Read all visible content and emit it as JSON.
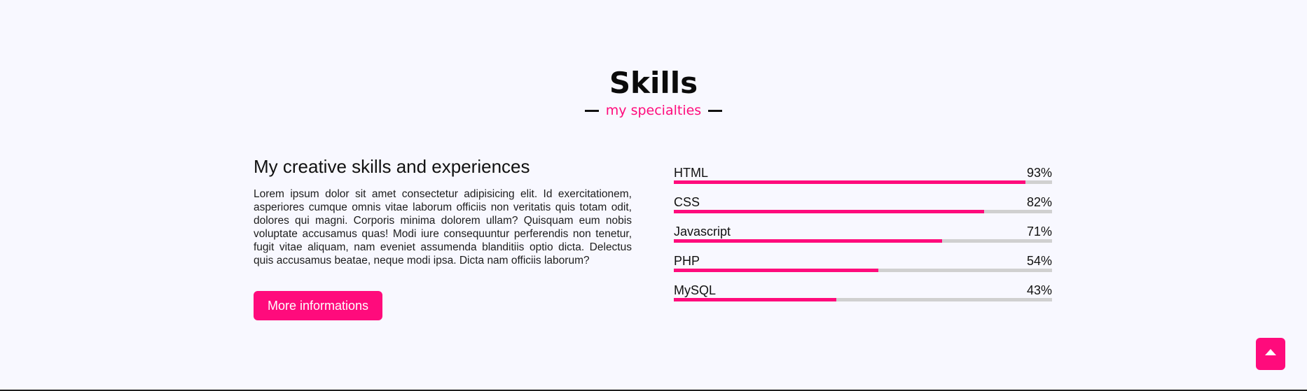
{
  "section": {
    "title": "Skills",
    "subtitle": "my specialties"
  },
  "left": {
    "heading": "My creative skills and experiences",
    "paragraph": "Lorem ipsum dolor sit amet consectetur adipisicing elit. Id exercitationem, asperiores cumque omnis vitae laborum officiis non veritatis quis totam odit, dolores qui magni. Corporis minima dolorem ullam? Quisquam eum nobis voluptate accusamus quas! Modi iure consequuntur perferendis non tenetur, fugit vitae aliquam, nam eveniet assumenda blanditiis optio dicta. Delectus quis accusamus beatae, neque modi ipsa. Dicta nam officiis laborum?",
    "button_label": "More informations"
  },
  "skills": [
    {
      "name": "HTML",
      "percent_label": "93%",
      "value": 93
    },
    {
      "name": "CSS",
      "percent_label": "82%",
      "value": 82
    },
    {
      "name": "Javascript",
      "percent_label": "71%",
      "value": 71
    },
    {
      "name": "PHP",
      "percent_label": "54%",
      "value": 54
    },
    {
      "name": "MySQL",
      "percent_label": "43%",
      "value": 43
    }
  ],
  "ui": {
    "scroll_top_icon": "caret-up-icon",
    "accent_color": "#ff0b7c",
    "track_color": "#d0d0d0"
  }
}
